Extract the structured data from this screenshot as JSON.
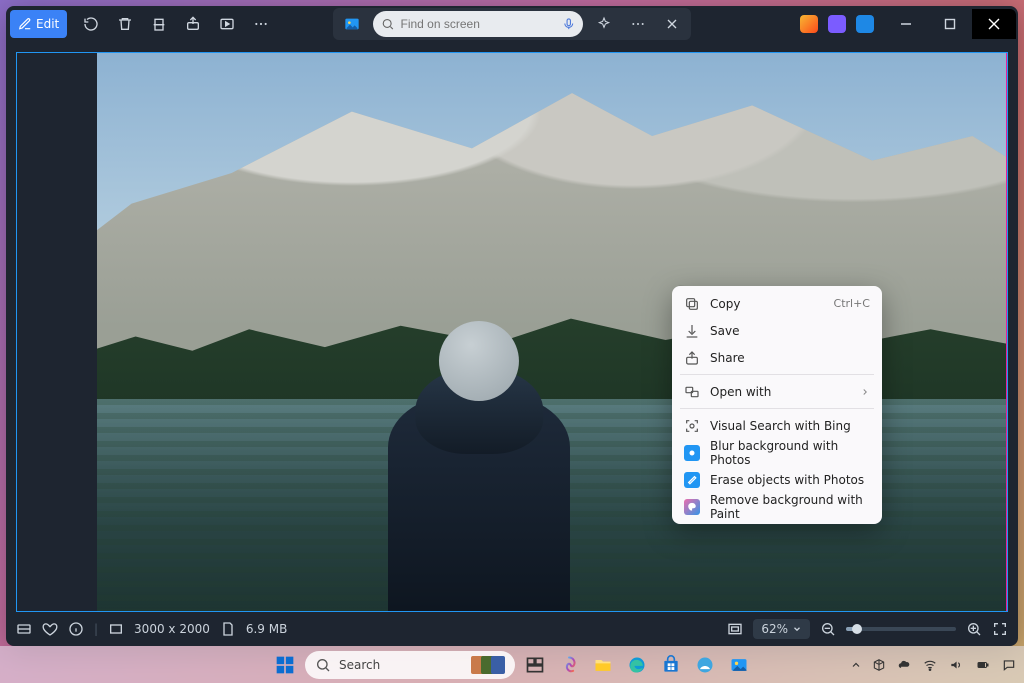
{
  "titlebar": {
    "edit_label": "Edit",
    "search_placeholder": "Find on screen"
  },
  "context_menu": {
    "items": [
      {
        "label": "Copy",
        "accel": "Ctrl+C",
        "icon": "copy-icon"
      },
      {
        "label": "Save",
        "icon": "save-icon"
      },
      {
        "label": "Share",
        "icon": "share-icon"
      },
      {
        "label": "Open with",
        "icon": "open-with-icon",
        "submenu": true
      },
      {
        "label": "Visual Search with Bing",
        "icon": "visual-search-icon"
      },
      {
        "label": "Blur background with Photos",
        "icon": "photos-blur-icon",
        "blue": true
      },
      {
        "label": "Erase objects with Photos",
        "icon": "photos-erase-icon",
        "blue": true
      },
      {
        "label": "Remove background with Paint",
        "icon": "paint-icon",
        "paint": true
      }
    ]
  },
  "status": {
    "dimensions": "3000 x 2000",
    "filesize": "6.9 MB",
    "zoom": "62%"
  },
  "taskbar": {
    "search_label": "Search"
  }
}
